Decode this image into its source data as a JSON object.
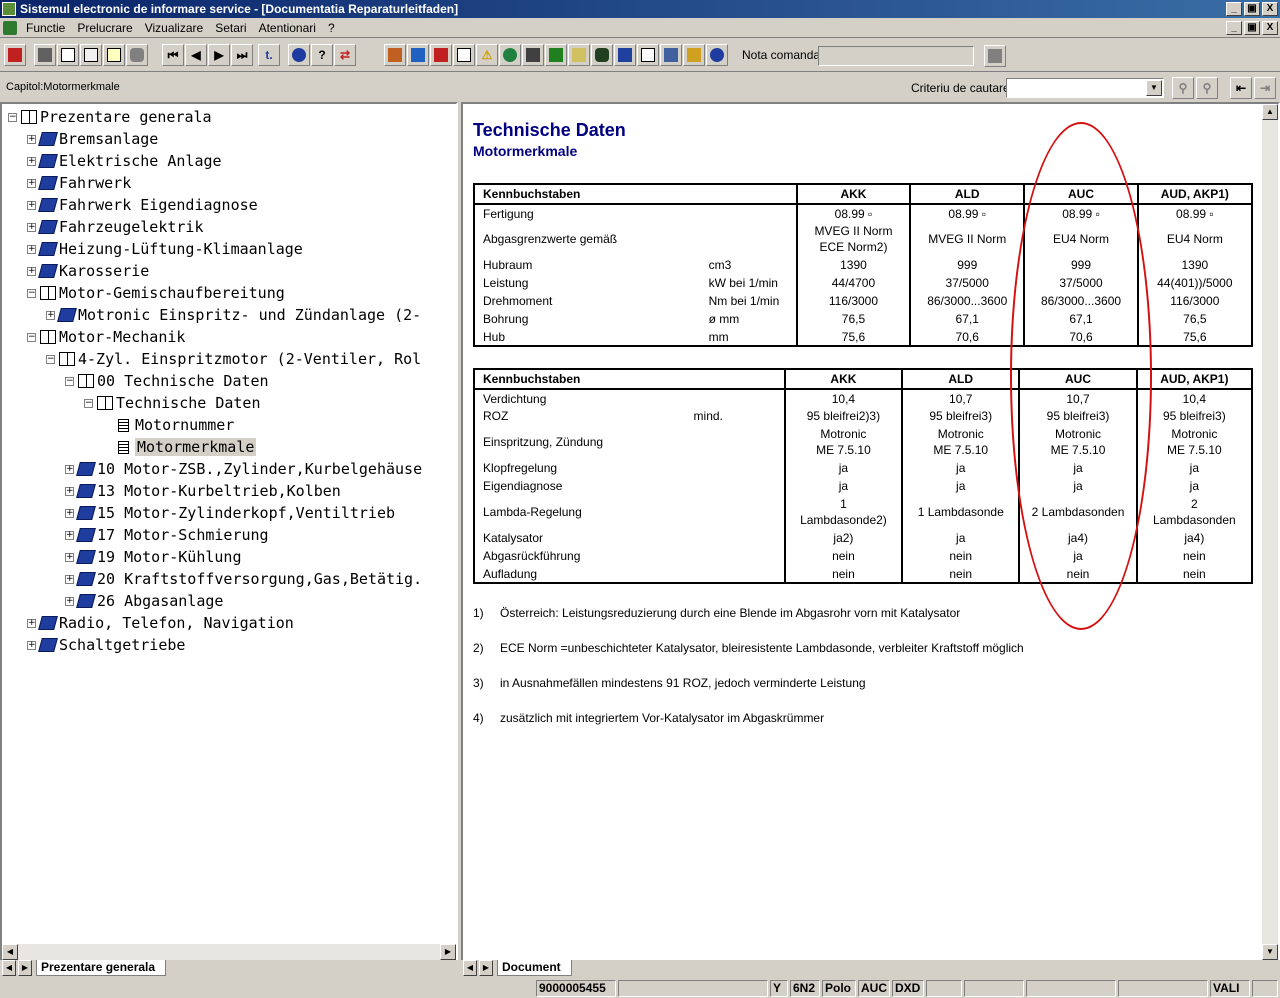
{
  "window": {
    "title": "Sistemul electronic de informare service - [Documentatia Reparaturleitfaden]",
    "btn_min": "_",
    "btn_max": "▣",
    "btn_close": "X"
  },
  "menu": [
    "Functie",
    "Prelucrare",
    "Vizualizare",
    "Setari",
    "Atentionari",
    "?"
  ],
  "toolbar": {
    "nota_label": "Nota comanda:",
    "nota_value": ""
  },
  "capitol": "Capitol:Motormerkmale",
  "criteriu": {
    "label": "Criteriu de cautare:",
    "value": ""
  },
  "tree": [
    {
      "label": "Prezentare generala",
      "level": 0,
      "icon": "book-open-icon",
      "expander": "−"
    },
    {
      "label": "Bremsanlage",
      "level": 1,
      "icon": "book-closed-icon",
      "expander": "+"
    },
    {
      "label": "Elektrische Anlage",
      "level": 1,
      "icon": "book-closed-icon",
      "expander": "+"
    },
    {
      "label": "Fahrwerk",
      "level": 1,
      "icon": "book-closed-icon",
      "expander": "+"
    },
    {
      "label": "Fahrwerk Eigendiagnose",
      "level": 1,
      "icon": "book-closed-icon",
      "expander": "+"
    },
    {
      "label": "Fahrzeugelektrik",
      "level": 1,
      "icon": "book-closed-icon",
      "expander": "+"
    },
    {
      "label": "Heizung-Lüftung-Klimaanlage",
      "level": 1,
      "icon": "book-closed-icon",
      "expander": "+"
    },
    {
      "label": "Karosserie",
      "level": 1,
      "icon": "book-closed-icon",
      "expander": "+"
    },
    {
      "label": "Motor-Gemischaufbereitung",
      "level": 1,
      "icon": "book-open-icon",
      "expander": "−"
    },
    {
      "label": "Motronic Einspritz- und Zündanlage (2-",
      "level": 2,
      "icon": "book-closed-icon",
      "expander": "+"
    },
    {
      "label": "Motor-Mechanik",
      "level": 1,
      "icon": "book-open-icon",
      "expander": "−"
    },
    {
      "label": "4-Zyl. Einspritzmotor (2-Ventiler, Rol",
      "level": 2,
      "icon": "book-open-icon",
      "expander": "−"
    },
    {
      "label": "00 Technische Daten",
      "level": 3,
      "icon": "book-open-icon",
      "expander": "−"
    },
    {
      "label": "Technische Daten",
      "level": 4,
      "icon": "book-open-icon",
      "expander": "−"
    },
    {
      "label": "Motornummer",
      "level": 5,
      "icon": "page-icon",
      "expander": ""
    },
    {
      "label": "Motormerkmale",
      "level": 5,
      "icon": "page-icon",
      "expander": "",
      "selected": true
    },
    {
      "label": "10 Motor-ZSB.,Zylinder,Kurbelgehäuse",
      "level": 3,
      "icon": "book-closed-icon",
      "expander": "+"
    },
    {
      "label": "13 Motor-Kurbeltrieb,Kolben",
      "level": 3,
      "icon": "book-closed-icon",
      "expander": "+"
    },
    {
      "label": "15 Motor-Zylinderkopf,Ventiltrieb",
      "level": 3,
      "icon": "book-closed-icon",
      "expander": "+"
    },
    {
      "label": "17 Motor-Schmierung",
      "level": 3,
      "icon": "book-closed-icon",
      "expander": "+"
    },
    {
      "label": "19 Motor-Kühlung",
      "level": 3,
      "icon": "book-closed-icon",
      "expander": "+"
    },
    {
      "label": "20 Kraftstoffversorgung,Gas,Betätig.",
      "level": 3,
      "icon": "book-closed-icon",
      "expander": "+"
    },
    {
      "label": "26 Abgasanlage",
      "level": 3,
      "icon": "book-closed-icon",
      "expander": "+"
    },
    {
      "label": "Radio, Telefon, Navigation",
      "level": 1,
      "icon": "book-closed-icon",
      "expander": "+"
    },
    {
      "label": "Schaltgetriebe",
      "level": 1,
      "icon": "book-closed-icon",
      "expander": "+"
    }
  ],
  "left_tab": "Prezentare generala",
  "right_tab": "Document",
  "doc": {
    "title": "Technische Daten",
    "subtitle": "Motormerkmale",
    "table1": {
      "header": [
        "Kennbuchstaben",
        "",
        "AKK",
        "ALD",
        "AUC",
        "AUD, AKP1)"
      ],
      "rows": [
        [
          "Fertigung",
          "",
          "08.99 ▫",
          "08.99 ▫",
          "08.99 ▫",
          "08.99 ▫"
        ],
        [
          "Abgasgrenzwerte gemäß",
          "",
          "MVEG II Norm\nECE Norm2)",
          "MVEG II Norm",
          "EU4 Norm",
          "EU4 Norm"
        ],
        [
          "Hubraum",
          "cm3",
          "1390",
          "999",
          "999",
          "1390"
        ],
        [
          "Leistung",
          "kW bei 1/min",
          "44/4700",
          "37/5000",
          "37/5000",
          "44(401))/5000"
        ],
        [
          "Drehmoment",
          "Nm bei 1/min",
          "116/3000",
          "86/3000...3600",
          "86/3000...3600",
          "116/3000"
        ],
        [
          "Bohrung",
          "ø mm",
          "76,5",
          "67,1",
          "67,1",
          "76,5"
        ],
        [
          "Hub",
          "mm",
          "75,6",
          "70,6",
          "70,6",
          "75,6"
        ]
      ]
    },
    "table2": {
      "header": [
        "Kennbuchstaben",
        "",
        "AKK",
        "ALD",
        "AUC",
        "AUD, AKP1)"
      ],
      "rows": [
        [
          "Verdichtung",
          "",
          "10,4",
          "10,7",
          "10,7",
          "10,4"
        ],
        [
          "ROZ",
          "mind.",
          "95 bleifrei2)3)",
          "95 bleifrei3)",
          "95 bleifrei3)",
          "95 bleifrei3)"
        ],
        [
          "Einspritzung, Zündung",
          "",
          "Motronic\nME 7.5.10",
          "Motronic\nME 7.5.10",
          "Motronic\nME 7.5.10",
          "Motronic\nME 7.5.10"
        ],
        [
          "Klopfregelung",
          "",
          "ja",
          "ja",
          "ja",
          "ja"
        ],
        [
          "Eigendiagnose",
          "",
          "ja",
          "ja",
          "ja",
          "ja"
        ],
        [
          "Lambda-Regelung",
          "",
          "1\nLambdasonde2)",
          "1 Lambdasonde",
          "2 Lambdasonden",
          "2\nLambdasonden"
        ],
        [
          "Katalysator",
          "",
          "ja2)",
          "ja",
          "ja4)",
          "ja4)"
        ],
        [
          "Abgasrückführung",
          "",
          "nein",
          "nein",
          "ja",
          "nein"
        ],
        [
          "Aufladung",
          "",
          "nein",
          "nein",
          "nein",
          "nein"
        ]
      ]
    },
    "footnotes": [
      {
        "num": "1)",
        "text": "Österreich: Leistungsreduzierung durch eine Blende im Abgasrohr vorn mit Katalysator"
      },
      {
        "num": "2)",
        "text": "ECE Norm =unbeschichteter Katalysator, bleiresistente Lambdasonde, verbleiter Kraftstoff möglich"
      },
      {
        "num": "3)",
        "text": "in Ausnahmefällen mindestens 91 ROZ, jedoch verminderte Leistung"
      },
      {
        "num": "4)",
        "text": "zusätzlich mit integriertem Vor-Katalysator im Abgaskrümmer"
      }
    ]
  },
  "status": {
    "order_no": "9000005455",
    "f1": "Y",
    "f2": "6N2",
    "f3": "Polo",
    "f4": "AUC",
    "f5": "DXD",
    "f6": "VALI"
  }
}
